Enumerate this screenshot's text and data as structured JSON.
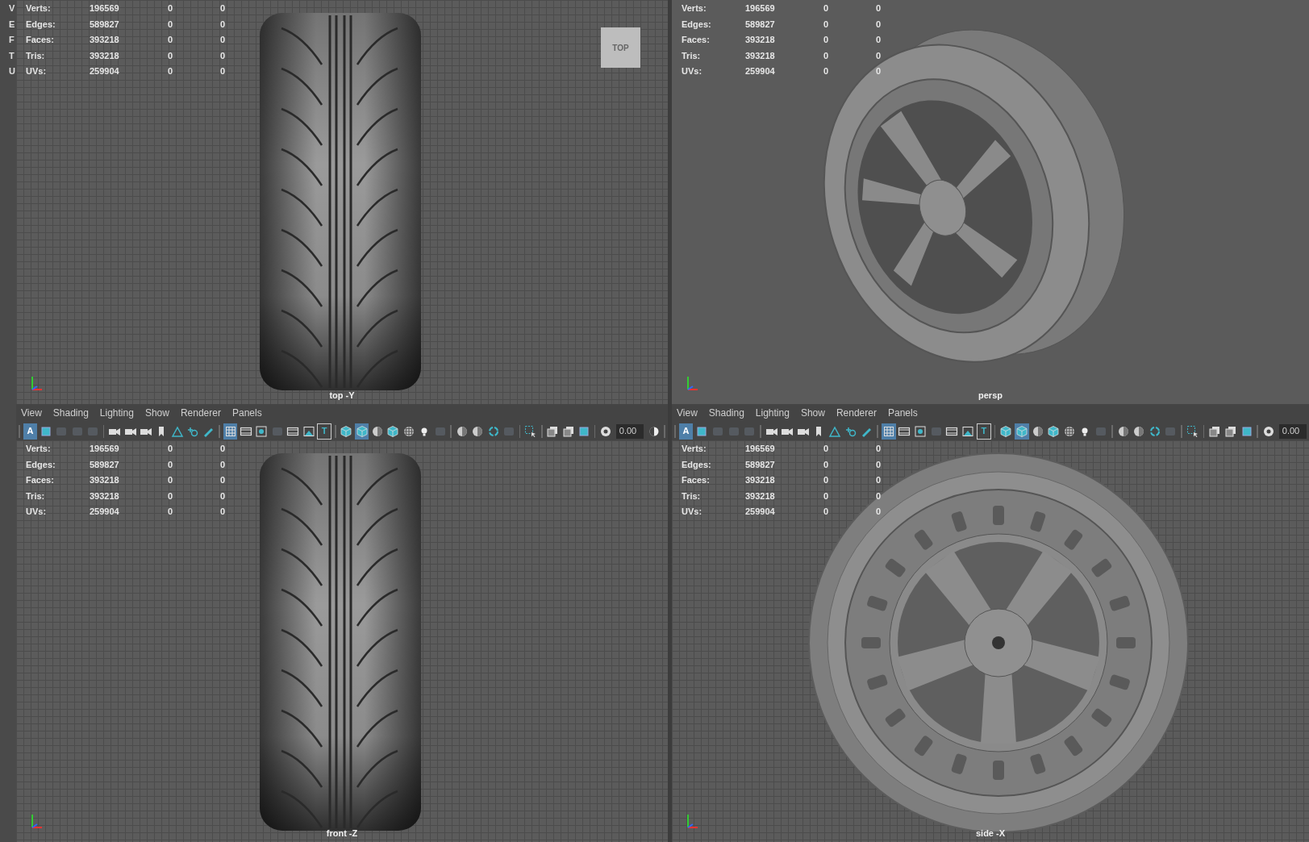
{
  "side_strip": [
    "V",
    "E",
    "F",
    "T",
    "U"
  ],
  "panes": [
    {
      "label": "top -Y",
      "grid": true,
      "kind": "tread",
      "view_cube": "TOP",
      "stats": [
        {
          "label": "Verts:",
          "values": [
            "196569",
            "0",
            "0"
          ]
        },
        {
          "label": "Edges:",
          "values": [
            "589827",
            "0",
            "0"
          ]
        },
        {
          "label": "Faces:",
          "values": [
            "393218",
            "0",
            "0"
          ]
        },
        {
          "label": "Tris:",
          "values": [
            "393218",
            "0",
            "0"
          ]
        },
        {
          "label": "UVs:",
          "values": [
            "259904",
            "0",
            "0"
          ]
        }
      ]
    },
    {
      "label": "persp",
      "grid": false,
      "kind": "angled",
      "stats": [
        {
          "label": "Verts:",
          "values": [
            "196569",
            "0",
            "0"
          ]
        },
        {
          "label": "Edges:",
          "values": [
            "589827",
            "0",
            "0"
          ]
        },
        {
          "label": "Faces:",
          "values": [
            "393218",
            "0",
            "0"
          ]
        },
        {
          "label": "Tris:",
          "values": [
            "393218",
            "0",
            "0"
          ]
        },
        {
          "label": "UVs:",
          "values": [
            "259904",
            "0",
            "0"
          ]
        }
      ]
    },
    {
      "label": "front -Z",
      "grid": true,
      "kind": "tread",
      "menu": [
        "View",
        "Shading",
        "Lighting",
        "Show",
        "Renderer",
        "Panels"
      ],
      "toolbar": [
        {
          "kind": "separator"
        },
        {
          "kind": "letter",
          "glyph": "A",
          "selected": true
        },
        {
          "kind": "frame",
          "selected": false
        },
        {
          "kind": "dim",
          "selected": false
        },
        {
          "kind": "dim",
          "selected": false
        },
        {
          "kind": "dim",
          "selected": false
        },
        {
          "kind": "separator"
        },
        {
          "kind": "camera",
          "selected": false
        },
        {
          "kind": "camera",
          "selected": false
        },
        {
          "kind": "camera",
          "selected": false
        },
        {
          "kind": "bookmark",
          "selected": false
        },
        {
          "kind": "plane",
          "selected": false
        },
        {
          "kind": "move",
          "selected": false
        },
        {
          "kind": "pencil",
          "selected": false
        },
        {
          "kind": "separator"
        },
        {
          "kind": "grid",
          "selected": true
        },
        {
          "kind": "film",
          "selected": false
        },
        {
          "kind": "dot",
          "selected": false
        },
        {
          "kind": "dim",
          "selected": false
        },
        {
          "kind": "film",
          "selected": false
        },
        {
          "kind": "image",
          "selected": false
        },
        {
          "kind": "letter",
          "glyph": "T",
          "selected": false
        },
        {
          "kind": "separator"
        },
        {
          "kind": "cube",
          "selected": false
        },
        {
          "kind": "cube",
          "selected": true
        },
        {
          "kind": "sphere",
          "selected": false
        },
        {
          "kind": "cube",
          "selected": false
        },
        {
          "kind": "checker",
          "selected": false
        },
        {
          "kind": "light",
          "selected": false
        },
        {
          "kind": "dim",
          "selected": false
        },
        {
          "kind": "separator"
        },
        {
          "kind": "sphere",
          "selected": false
        },
        {
          "kind": "sphere",
          "selected": false
        },
        {
          "kind": "ring",
          "selected": false
        },
        {
          "kind": "dim",
          "selected": false
        },
        {
          "kind": "separator"
        },
        {
          "kind": "cursor",
          "selected": false
        },
        {
          "kind": "separator"
        },
        {
          "kind": "layers",
          "selected": false
        },
        {
          "kind": "layers",
          "selected": false
        },
        {
          "kind": "frame",
          "selected": false
        },
        {
          "kind": "separator"
        },
        {
          "kind": "aperture",
          "selected": false
        },
        {
          "kind": "field",
          "value": "0.00"
        },
        {
          "kind": "half",
          "selected": false
        },
        {
          "kind": "separator"
        }
      ],
      "stats": [
        {
          "label": "Verts:",
          "values": [
            "196569",
            "0",
            "0"
          ]
        },
        {
          "label": "Edges:",
          "values": [
            "589827",
            "0",
            "0"
          ]
        },
        {
          "label": "Faces:",
          "values": [
            "393218",
            "0",
            "0"
          ]
        },
        {
          "label": "Tris:",
          "values": [
            "393218",
            "0",
            "0"
          ]
        },
        {
          "label": "UVs:",
          "values": [
            "259904",
            "0",
            "0"
          ]
        }
      ]
    },
    {
      "label": "side -X",
      "grid": true,
      "kind": "side",
      "menu": [
        "View",
        "Shading",
        "Lighting",
        "Show",
        "Renderer",
        "Panels"
      ],
      "toolbar": [
        {
          "kind": "separator"
        },
        {
          "kind": "letter",
          "glyph": "A",
          "selected": true
        },
        {
          "kind": "frame",
          "selected": false
        },
        {
          "kind": "dim",
          "selected": false
        },
        {
          "kind": "dim",
          "selected": false
        },
        {
          "kind": "dim",
          "selected": false
        },
        {
          "kind": "separator"
        },
        {
          "kind": "camera",
          "selected": false
        },
        {
          "kind": "camera",
          "selected": false
        },
        {
          "kind": "camera",
          "selected": false
        },
        {
          "kind": "bookmark",
          "selected": false
        },
        {
          "kind": "plane",
          "selected": false
        },
        {
          "kind": "move",
          "selected": false
        },
        {
          "kind": "pencil",
          "selected": false
        },
        {
          "kind": "separator"
        },
        {
          "kind": "grid",
          "selected": true
        },
        {
          "kind": "film",
          "selected": false
        },
        {
          "kind": "dot",
          "selected": false
        },
        {
          "kind": "dim",
          "selected": false
        },
        {
          "kind": "film",
          "selected": false
        },
        {
          "kind": "image",
          "selected": false
        },
        {
          "kind": "letter",
          "glyph": "T",
          "selected": false
        },
        {
          "kind": "separator"
        },
        {
          "kind": "cube",
          "selected": false
        },
        {
          "kind": "cube",
          "selected": true
        },
        {
          "kind": "sphere",
          "selected": false
        },
        {
          "kind": "cube",
          "selected": false
        },
        {
          "kind": "checker",
          "selected": false
        },
        {
          "kind": "light",
          "selected": false
        },
        {
          "kind": "dim",
          "selected": false
        },
        {
          "kind": "separator"
        },
        {
          "kind": "sphere",
          "selected": false
        },
        {
          "kind": "sphere",
          "selected": false
        },
        {
          "kind": "ring",
          "selected": false
        },
        {
          "kind": "dim",
          "selected": false
        },
        {
          "kind": "separator"
        },
        {
          "kind": "cursor",
          "selected": false
        },
        {
          "kind": "separator"
        },
        {
          "kind": "layers",
          "selected": false
        },
        {
          "kind": "layers",
          "selected": false
        },
        {
          "kind": "frame",
          "selected": false
        },
        {
          "kind": "separator"
        },
        {
          "kind": "aperture",
          "selected": false
        },
        {
          "kind": "field",
          "value": "0.00"
        }
      ],
      "stats": [
        {
          "label": "Verts:",
          "values": [
            "196569",
            "0",
            "0"
          ]
        },
        {
          "label": "Edges:",
          "values": [
            "589827",
            "0",
            "0"
          ]
        },
        {
          "label": "Faces:",
          "values": [
            "393218",
            "0",
            "0"
          ]
        },
        {
          "label": "Tris:",
          "values": [
            "393218",
            "0",
            "0"
          ]
        },
        {
          "label": "UVs:",
          "values": [
            "259904",
            "0",
            "0"
          ]
        }
      ]
    }
  ]
}
